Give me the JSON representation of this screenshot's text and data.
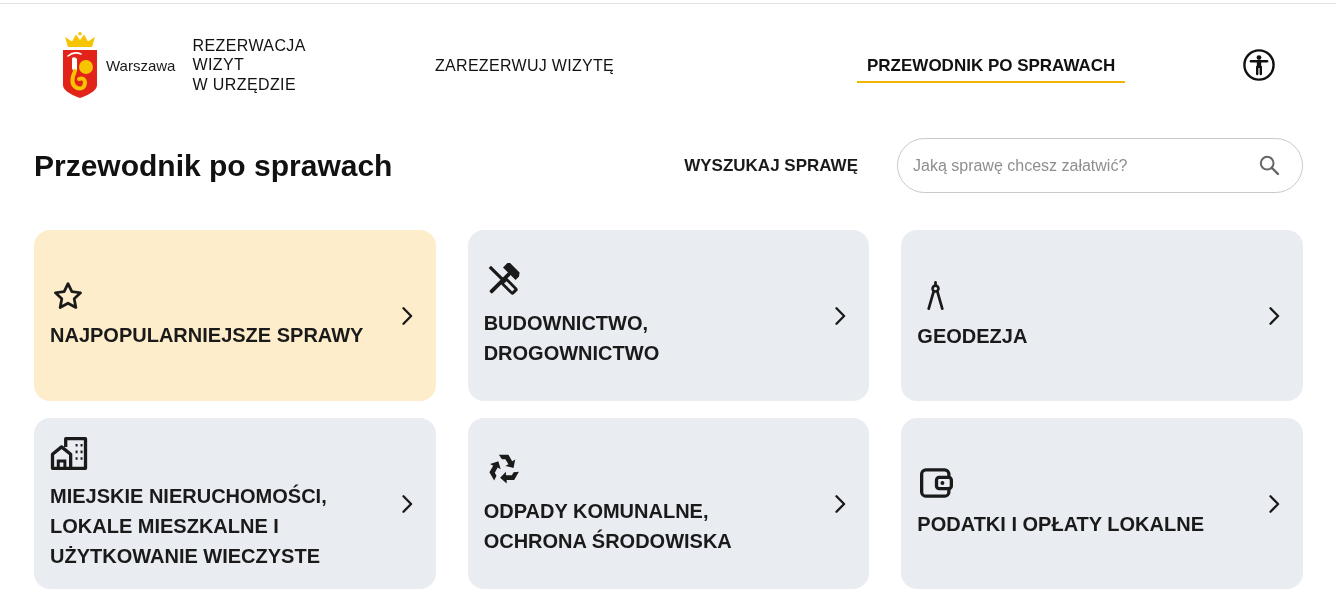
{
  "header": {
    "logo": {
      "text": "Warszawa"
    },
    "app_title": [
      "REZERWACJA",
      "WIZYT",
      "W URZĘDZIE"
    ],
    "nav": [
      {
        "label": "ZAREZERWUJ WIZYTĘ",
        "selected": false
      },
      {
        "label": "PRZEWODNIK PO SPRAWACH",
        "selected": true
      }
    ]
  },
  "page": {
    "title": "Przewodnik po sprawach",
    "search": {
      "label": "WYSZUKAJ SPRAWĘ",
      "placeholder": "Jaką sprawę chcesz załatwić?"
    }
  },
  "categories": [
    {
      "label": "NAJPOPULARNIEJSZE SPRAWY",
      "selected": true
    },
    {
      "label": "BUDOWNICTWO, DROGOWNICTWO",
      "selected": false
    },
    {
      "label": "GEODEZJA",
      "selected": false
    },
    {
      "label": "MIEJSKIE NIERUCHOMOŚCI, LOKALE MIESZKALNE I UŻYTKOWANIE WIECZYSTE",
      "selected": false
    },
    {
      "label": "ODPADY KOMUNALNE, OCHRONA ŚRODOWISKA",
      "selected": false
    },
    {
      "label": "PODATKI I OPŁATY LOKALNE",
      "selected": false
    }
  ]
}
